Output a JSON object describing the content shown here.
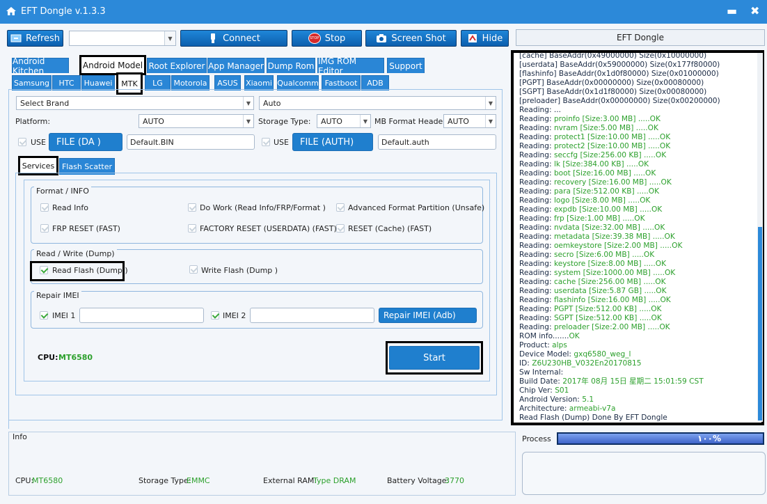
{
  "app": {
    "title": "EFT Dongle  v.1.3.3",
    "minimize": "▬",
    "close": "✖"
  },
  "toolbar": {
    "refresh": "Refresh",
    "connect": "Connect",
    "stop": "Stop",
    "screenshot": "Screen Shot",
    "hide": "Hide",
    "stop_badge": "STOP"
  },
  "tabs_main": [
    "Android Kitchen",
    "Android Model",
    "Root Explorer",
    "App Manager",
    "Dump Rom",
    "IMG ROM Editor",
    "Support"
  ],
  "tabs_brand": [
    "Samsung",
    "HTC",
    "Huawei",
    "MTK",
    "LG",
    "Motorola",
    "ASUS",
    "Xiaomi",
    "Qualcomm",
    "Fastboot",
    "ADB"
  ],
  "form": {
    "brand_select": "Select Brand",
    "auto1": "Auto",
    "platform_label": "Platform:",
    "platform_value": "AUTO",
    "storage_label": "Storage Type:",
    "storage_value": "AUTO",
    "mbformat_label": "MB Format Header",
    "mbformat_value": "AUTO",
    "use1": "USE",
    "file_da": "FILE (DA )",
    "da_value": "Default.BIN",
    "use2": "USE",
    "file_auth": "FILE (AUTH)",
    "auth_value": "Default.auth"
  },
  "subtabs": [
    "Services",
    "Flash Scatter"
  ],
  "format_group": {
    "title": "Format / INFO",
    "items": [
      "Read Info",
      "Do Work (Read Info/FRP/Format )",
      "Advanced Format Partition (Unsafe)",
      "FRP RESET (FAST)",
      "FACTORY RESET (USERDATA) (FAST)",
      "RESET (Cache) (FAST)"
    ]
  },
  "rw_group": {
    "title": "Read / Write (Dump)",
    "read_flash": "Read Flash (Dump )",
    "write_flash": "Write Flash (Dump )"
  },
  "imei_group": {
    "title": "Repair IMEI",
    "imei1": "IMEI 1",
    "imei2": "IMEI 2",
    "repair_btn": "Repair IMEI (Adb)"
  },
  "cpu": {
    "label": "CPU:",
    "value": "MT6580"
  },
  "start": "Start",
  "info": {
    "title": "Info",
    "cpu_label": "CPU:",
    "cpu_value": "MT6580",
    "storage_label": "Storage Type:",
    "storage_value": "EMMC",
    "ram_label": "External RAM:",
    "ram_value": "Type DRAM",
    "batt_label": "Battery Voltage:",
    "batt_value": "3770"
  },
  "right": {
    "header": "EFT Dongle",
    "process_label": "Process",
    "progress_text": "١٠٠%",
    "progress": 1.0
  },
  "colors": {
    "accent": "#2c89d9",
    "ok": "#2ca02c",
    "dark": "#1a2a44"
  },
  "log": [
    [
      "[cache] BaseAddr(0x49000000) Size(0x10000000)",
      ""
    ],
    [
      "[userdata] BaseAddr(0x59000000) Size(0x177f80000)",
      ""
    ],
    [
      "[flashinfo] BaseAddr(0x1d0f80000) Size(0x01000000)",
      ""
    ],
    [
      "[PGPT] BaseAddr(0x00000000) Size(0x00080000)",
      ""
    ],
    [
      "[SGPT] BaseAddr(0x1d1f80000) Size(0x00080000)",
      ""
    ],
    [
      "[preloader] BaseAddr(0x00000000) Size(0x00200000)",
      ""
    ],
    [
      "Reading: ...",
      ""
    ],
    [
      "Reading: ",
      "proinfo [Size:3.00 MB] .....OK"
    ],
    [
      "Reading: ",
      "nvram [Size:5.00 MB] .....OK"
    ],
    [
      "Reading: ",
      "protect1 [Size:10.00 MB] .....OK"
    ],
    [
      "Reading: ",
      "protect2 [Size:10.00 MB] .....OK"
    ],
    [
      "Reading: ",
      "seccfg [Size:256.00 KB] .....OK"
    ],
    [
      "Reading: ",
      "lk [Size:384.00 KB] .....OK"
    ],
    [
      "Reading: ",
      "boot [Size:16.00 MB] .....OK"
    ],
    [
      "Reading: ",
      "recovery [Size:16.00 MB] .....OK"
    ],
    [
      "Reading: ",
      "para [Size:512.00 KB] .....OK"
    ],
    [
      "Reading: ",
      "logo [Size:8.00 MB] .....OK"
    ],
    [
      "Reading: ",
      "expdb [Size:10.00 MB] .....OK"
    ],
    [
      "Reading: ",
      "frp [Size:1.00 MB] .....OK"
    ],
    [
      "Reading: ",
      "nvdata [Size:32.00 MB] .....OK"
    ],
    [
      "Reading: ",
      "metadata [Size:39.38 MB] .....OK"
    ],
    [
      "Reading: ",
      "oemkeystore [Size:2.00 MB] .....OK"
    ],
    [
      "Reading: ",
      "secro [Size:6.00 MB] .....OK"
    ],
    [
      "Reading: ",
      "keystore [Size:8.00 MB] .....OK"
    ],
    [
      "Reading: ",
      "system [Size:1000.00 MB] .....OK"
    ],
    [
      "Reading: ",
      "cache [Size:256.00 MB] .....OK"
    ],
    [
      "Reading: ",
      "userdata [Size:5.87 GB] .....OK"
    ],
    [
      "Reading: ",
      "flashinfo [Size:16.00 MB] .....OK"
    ],
    [
      "Reading: ",
      "PGPT [Size:512.00 KB] .....OK"
    ],
    [
      "Reading: ",
      "SGPT [Size:512.00 KB] .....OK"
    ],
    [
      "Reading: ",
      "preloader [Size:2.00 MB] .....OK"
    ],
    [
      "ROM info.......",
      "OK"
    ],
    [
      "Product: ",
      "alps"
    ],
    [
      "Device Model: ",
      "gxq6580_weg_l"
    ],
    [
      "ID: ",
      "Z6U230HB_V032En20170815"
    ],
    [
      "Sw Internal:",
      ""
    ],
    [
      "Build Date: ",
      "2017年 08月 15日 星期二 15:01:59 CST"
    ],
    [
      "Chip Ver: ",
      "S01"
    ],
    [
      "Android Version: ",
      "5.1"
    ],
    [
      "Architecture: ",
      "armeabi-v7a"
    ],
    [
      "Read Flash (Dump) Done By EFT Dongle",
      ""
    ]
  ]
}
